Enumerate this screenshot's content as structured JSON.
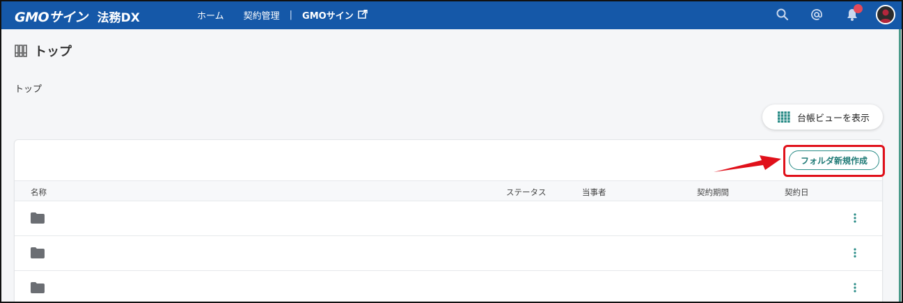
{
  "header": {
    "logo": "GMOサイン",
    "logo_sub": "法務DX",
    "nav": {
      "home": "ホーム",
      "contract_management": "契約管理",
      "separator": "|",
      "gmo_sign": "GMOサイン"
    },
    "icons": [
      "search-icon",
      "at-icon",
      "bell-icon",
      "avatar"
    ],
    "colors": {
      "bar": "#1558a8",
      "notification": "#e54a5a"
    }
  },
  "page": {
    "title": "トップ",
    "breadcrumb": "トップ"
  },
  "ledger_view_button": "台帳ビューを表示",
  "new_folder_button": "フォルダ新規作成",
  "table": {
    "columns": {
      "name": "名称",
      "status": "ステータス",
      "party": "当事者",
      "period": "契約期間",
      "date": "契約日"
    },
    "rows": [
      {
        "icon": "folder-icon"
      },
      {
        "icon": "folder-icon"
      },
      {
        "icon": "folder-icon"
      }
    ]
  },
  "colors": {
    "accent": "#2a8c87",
    "highlight": "#e0101a"
  }
}
